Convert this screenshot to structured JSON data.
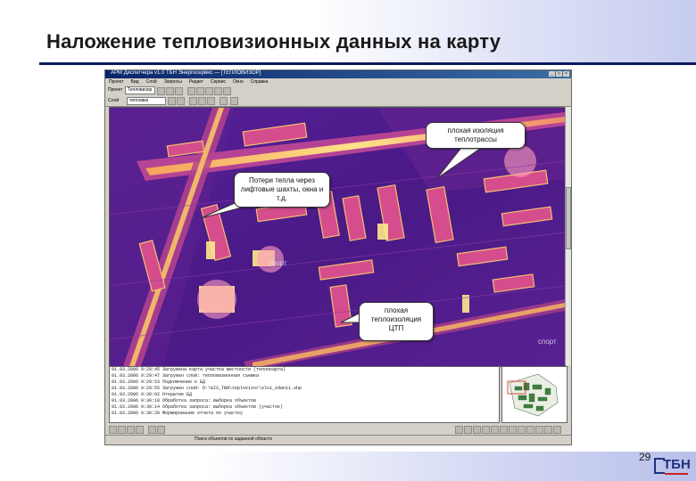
{
  "slide": {
    "title": "Наложение тепловизионных данных на карту",
    "page_number": "29",
    "logo_text": "ТБН"
  },
  "app": {
    "window_title": "АРМ Диспетчера v1.0 ТБН Энергосервис — [ТЕПЛОВИЗОР]",
    "menu": [
      "Проект",
      "Вид",
      "Слой",
      "Запросы",
      "Редакт",
      "Сервис",
      "Окно",
      "Справка"
    ],
    "toolbar": {
      "project_label": "Проект",
      "project_value": "Тепловизор",
      "layer_label": "Слой",
      "layer_value": "тепловиз"
    },
    "map_labels": [
      "спорт",
      "спорт"
    ],
    "log_lines": [
      "01.03.2006  9:29:45  Загружена карта участка местности (теплокарта)",
      "01.03.2006  9:29:47  Загружен слой: тепловизионная съемка",
      "01.03.2006  9:29:53  Подключение к БД",
      "01.03.2006  9:29:55  Загружен слой: D:\\GIS_TBN\\teplovizor\\sloi_zdanii.shp",
      "01.03.2006  9:30:02  Открытие БД",
      "01.03.2006  9:30:10  Обработка запроса: выборка объектов",
      "01.03.2006  9:30:14  Обработка запроса: выборка объектов (участок)",
      "01.03.2006  9:30:20  Формирование отчета по участку"
    ],
    "status_text": "Поиск объектов по заданной области"
  },
  "callouts": [
    {
      "text": "плохая изоляция теплотрассы"
    },
    {
      "text": "Потери тепла через лифтовые шахты, окна и т.д."
    },
    {
      "text": "плохая теплоизоляция ЦТП"
    }
  ],
  "colors": {
    "title_rule": "#0b1a5e",
    "thermal_bg": "#3a1a8a",
    "thermal_hot": "#f7d06a",
    "thermal_warm": "#d94a8a",
    "window_chrome": "#d4d0c8"
  }
}
